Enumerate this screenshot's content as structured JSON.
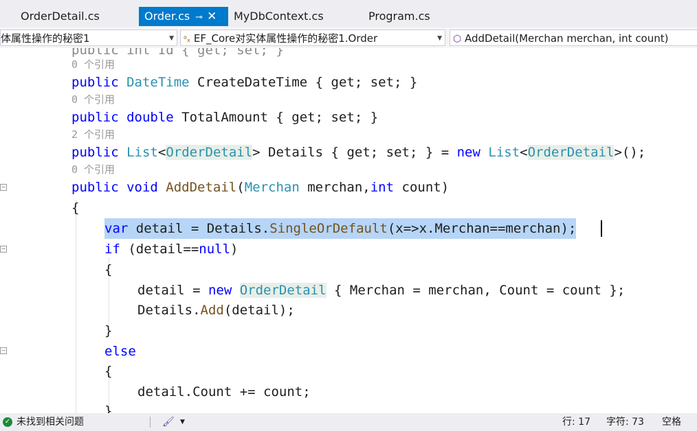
{
  "tabs": [
    {
      "label": "OrderDetail.cs",
      "active": false
    },
    {
      "label": "Order.cs",
      "active": true
    },
    {
      "label": "MyDbContext.cs",
      "active": false
    },
    {
      "label": "Program.cs",
      "active": false
    }
  ],
  "navbar": {
    "project": "体属性操作的秘密1",
    "class": "EF_Core对实体属性操作的秘密1.Order",
    "member": "AddDetail(Merchan merchan, int count)"
  },
  "code": {
    "line0": "public int Id { get; set; }",
    "ref0": "0 个引用",
    "line1_kw": "public",
    "line1_ty": "DateTime",
    "line1_rest": " CreateDateTime { get; set; }",
    "ref1": "0 个引用",
    "line2_kw": "public double",
    "line2_rest": " TotalAmount { get; set; }",
    "ref2": "2 个引用",
    "line3_kw": "public",
    "line3_ty1": "List",
    "line3_ty2": "OrderDetail",
    "line3_mid": " Details { get; set; } = ",
    "line3_new": "new",
    "line3_ty3": "List",
    "line3_ty4": "OrderDetail",
    "line3_end": "();",
    "ref3": "0 个引用",
    "line4_kw": "public void",
    "line4_mt": "AddDetail",
    "line4_ty": "Merchan",
    "line4_rest": " merchan,",
    "line4_int": "int",
    "line4_end": " count)",
    "brace_open": "{",
    "brace_close": "}",
    "line5_var": "var",
    "line5_a": " detail = Details.",
    "line5_mt": "SingleOrDefault",
    "line5_b": "(x=>x.Merchan==merchan);",
    "line6_if": "if",
    "line6_a": " (detail==",
    "line6_null": "null",
    "line6_b": ")",
    "line7_a": "detail = ",
    "line7_new": "new",
    "line7_ty": "OrderDetail",
    "line7_b": " { Merchan = merchan, Count = count };",
    "line8_a": "Details.",
    "line8_mt": "Add",
    "line8_b": "(detail);",
    "line9_else": "else",
    "line10": "detail.Count += count;"
  },
  "status": {
    "issues": "未找到相关问题",
    "line": "行: 17",
    "char": "字符: 73",
    "whitespace": "空格"
  },
  "colors": {
    "accent": "#007acc",
    "keyword": "#0000ff",
    "type": "#2b91af",
    "method": "#74531f",
    "selection": "#b6d5f7"
  }
}
